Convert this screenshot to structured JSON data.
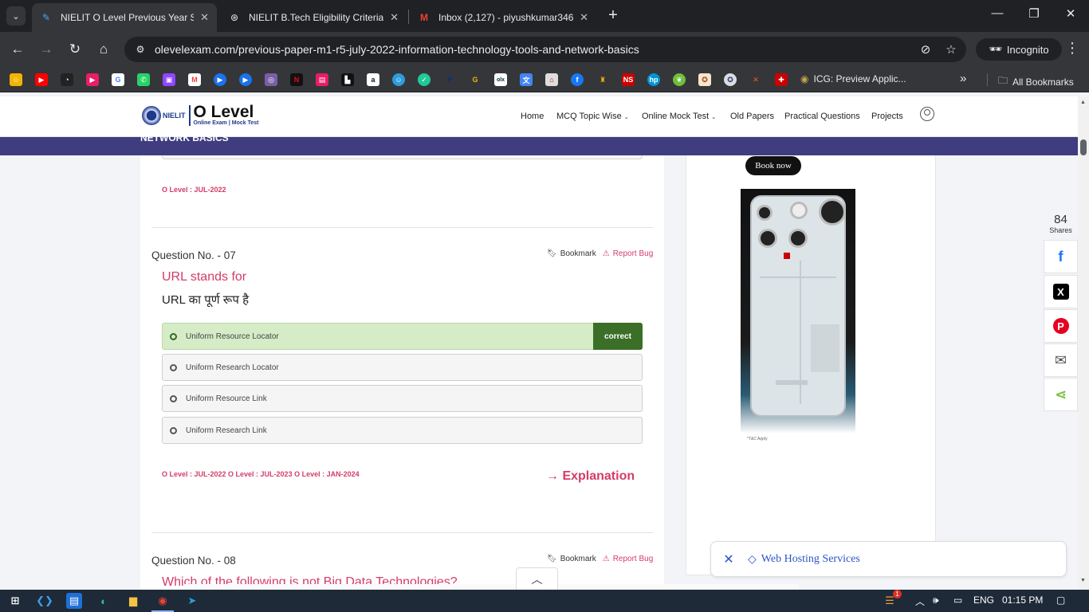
{
  "browser": {
    "tabs": [
      {
        "title": "NIELIT O Level Previous Year So",
        "icon": "olevel-icon",
        "active": true
      },
      {
        "title": "NIELIT B.Tech Eligibility Criteria",
        "icon": "chatgpt-icon",
        "active": false
      },
      {
        "title": "Inbox (2,127) - piyushkumar346",
        "icon": "gmail-icon",
        "active": false
      }
    ],
    "url": "olevelexam.com/previous-paper-m1-r5-july-2022-information-technology-tools-and-network-basics",
    "incognito_label": "Incognito",
    "bookmark_labels": {
      "icg": "ICG: Preview Applic...",
      "all": "All Bookmarks"
    }
  },
  "site": {
    "logo_small": "NIELIT",
    "logo_big": "O Level",
    "logo_sub": "Online Exam | Mock Test",
    "nav": [
      {
        "label": "Home"
      },
      {
        "label": "MCQ Topic Wise"
      },
      {
        "label": "Online Mock Test"
      },
      {
        "label": "Old Papers"
      },
      {
        "label": "Practical Questions"
      },
      {
        "label": "Projects"
      }
    ],
    "strip_text": "NETWORK BASICS"
  },
  "prev_question": {
    "tags": "O Level : JUL-2022"
  },
  "question7": {
    "number": "Question No. - 07",
    "bookmark": "Bookmark",
    "report": "Report Bug",
    "text_en": "URL stands for",
    "text_hi": "URL का पूर्ण रूप है",
    "options": [
      {
        "text": "Uniform Resource Locator",
        "correct": true
      },
      {
        "text": "Uniform Research Locator",
        "correct": false
      },
      {
        "text": "Uniform Resource Link",
        "correct": false
      },
      {
        "text": "Uniform Research Link",
        "correct": false
      }
    ],
    "correct_label": "correct",
    "tags": "O Level : JUL-2022 O Level : JUL-2023 O Level : JAN-2024",
    "explanation": "→ Explanation"
  },
  "question8": {
    "number": "Question No. - 08",
    "bookmark": "Bookmark",
    "report": "Report Bug",
    "text_en": "Which of the following is not Big Data Technologies?"
  },
  "sidebar": {
    "book_now": "Book now",
    "ad_footnote": "*T&C Apply"
  },
  "share": {
    "count": "84",
    "label": "Shares",
    "buttons": [
      {
        "name": "facebook",
        "color": "#1877f2",
        "glyph": "f"
      },
      {
        "name": "x",
        "color": "#000000",
        "glyph": "X"
      },
      {
        "name": "pinterest",
        "color": "#e60023",
        "glyph": "P"
      },
      {
        "name": "email",
        "color": "#555555",
        "glyph": "✉"
      },
      {
        "name": "share",
        "color": "#7bc043",
        "glyph": "<"
      }
    ]
  },
  "hosting_banner": {
    "label": "Web Hosting Services"
  },
  "taskbar": {
    "language": "ENG",
    "time": "01:15 PM",
    "badge": "1"
  }
}
